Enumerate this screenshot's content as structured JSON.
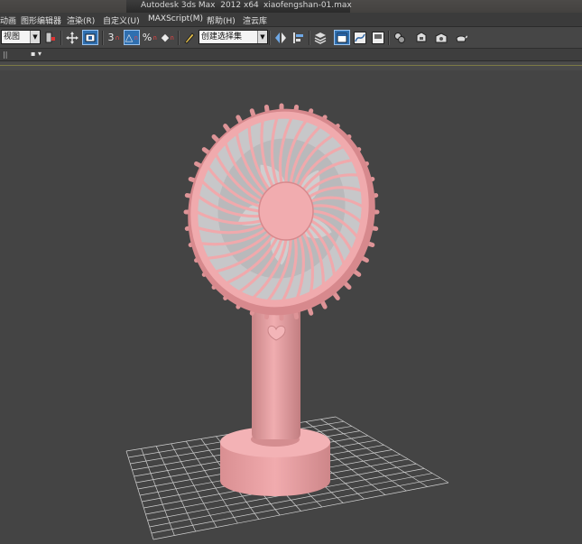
{
  "titlebar": {
    "app_title": "Autodesk 3ds Max  2012 x64",
    "file_name": "xiaofengshan-01.max"
  },
  "menu": {
    "items": [
      "动画",
      "图形编辑器",
      "渲染(R)",
      "自定义(U)",
      "MAXScript(M)",
      "帮助(H)",
      "渲云库"
    ]
  },
  "toolbar": {
    "reference_coord_value": "视图",
    "named_selection_value": "创建选择集",
    "snap_label": "3",
    "angle_snap_label": "△",
    "percent_snap_label": "%",
    "spinner_snap_label": "◆"
  },
  "strip": {
    "tick_label": "||",
    "view_menu_label": "▪ ▾"
  },
  "colors": {
    "viewport_bg": "#444444",
    "fan_pink": "#e8a3a6",
    "grid_line": "#cfcfcf",
    "active_tool": "#2f6fb0"
  },
  "icons": [
    "select-object-icon",
    "move-icon",
    "select-and-manipulate-icon",
    "snap-toggle-icon",
    "angle-snap-icon",
    "percent-snap-icon",
    "spinner-snap-icon",
    "edit-named-selection-icon",
    "mirror-icon",
    "align-icon",
    "layer-manager-icon",
    "graphite-ribbon-icon",
    "curve-editor-icon",
    "schematic-view-icon",
    "material-editor-icon",
    "render-setup-icon",
    "rendered-frame-icon",
    "render-production-icon"
  ]
}
